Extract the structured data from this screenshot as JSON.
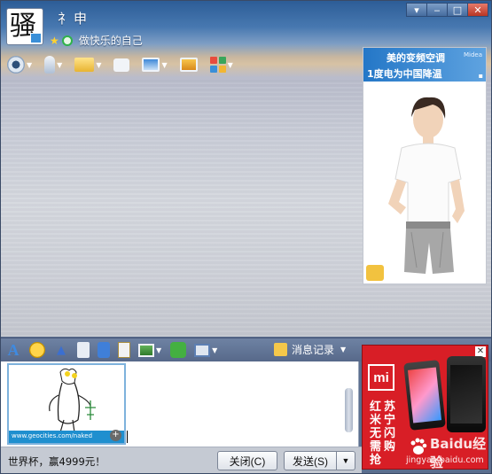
{
  "window": {
    "nickname": "礻申",
    "signature": "做快乐的自己",
    "avatar_glyph": "骚",
    "controls": [
      "minimize",
      "maximize",
      "close"
    ]
  },
  "main_toolbar": {
    "items": [
      {
        "name": "video-call-icon",
        "caret": true
      },
      {
        "name": "voice-call-icon",
        "caret": true
      },
      {
        "name": "send-file-icon",
        "caret": true
      },
      {
        "name": "create-discussion-icon",
        "caret": false
      },
      {
        "name": "remote-desktop-icon",
        "caret": true
      },
      {
        "name": "share-screen-icon",
        "caret": false
      },
      {
        "name": "app-center-icon",
        "caret": true
      }
    ]
  },
  "side_ad": {
    "line1": "美的变频空调",
    "line2": "1度电为中国降温",
    "brand": "Midea"
  },
  "input_toolbar": {
    "history_label": "消息记录"
  },
  "input_area": {
    "sticker_url": "www.geocities.com/naked"
  },
  "bottom": {
    "ad_text": "世界杯，赢4999元！",
    "close_label": "关闭(C)",
    "send_label": "发送(S)",
    "send_arrow": "▼"
  },
  "phone_ad": {
    "logo": "mi",
    "col1": "红米无需抢",
    "col2": "苏宁闪购",
    "watermark": "Baidu经验",
    "watermark_url": "jingyan.baidu.com"
  },
  "colors": {
    "sky_top": "#2c5c96",
    "toolbar": "#5e7193",
    "phone_ad_red": "#d81e26"
  }
}
